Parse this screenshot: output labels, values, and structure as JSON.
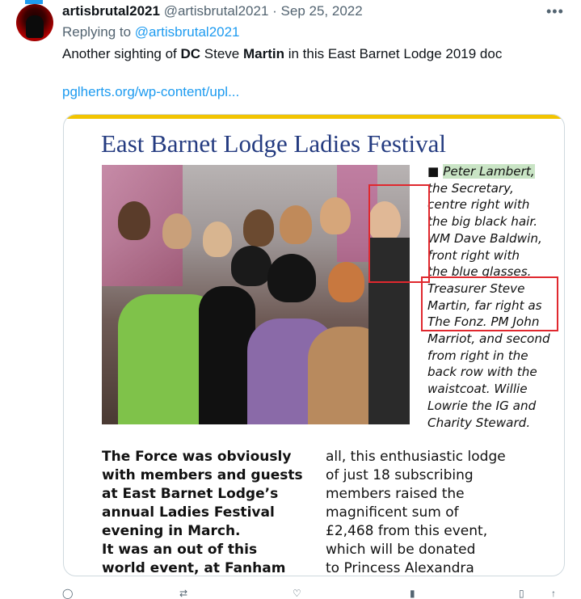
{
  "tweet": {
    "display_name": "artisbrutal2021",
    "handle": "@artisbrutal2021",
    "separator": "·",
    "date": "Sep 25, 2022",
    "more_label": "•••",
    "reply_prefix": "Replying to",
    "reply_handle": "@artisbrutal2021",
    "text_parts": [
      "Another sighting of ",
      "DC",
      " Steve ",
      "Martin",
      " in this East Barnet Lodge 2019 doc"
    ],
    "link_text": "pglherts.org/wp-content/upl..."
  },
  "document": {
    "title": "East Barnet Lodge Ladies Festival",
    "caption_lines": [
      "Peter Lambert,",
      "the Secretary,",
      "centre right with",
      "the big black hair.",
      "WM Dave Baldwin,",
      "front right with",
      "the blue glasses.",
      "Treasurer Steve",
      "Martin, far right as",
      "The Fonz. PM John",
      "Marriot, and second",
      "from right in the",
      "back row with the",
      "waistcoat. Willie",
      "Lowrie the IG and",
      "Charity Steward."
    ],
    "bullet": "■",
    "body_left_lines": [
      "The Force was obviously",
      "with members and guests",
      "at East Barnet Lodge’s",
      "annual Ladies Festival",
      "evening in March.",
      "It was an out of this",
      "world event, at Fanham"
    ],
    "body_right_lines": [
      "all, this enthusiastic lodge",
      "of just 18 subscribing",
      "members raised the",
      "magnificent sum of",
      "£2,468 from this event,",
      "which will be donated",
      "to Princess Alexandra"
    ]
  },
  "colors": {
    "link": "#1d9bf0",
    "title": "#243b80",
    "highlight_box": "#e0282e",
    "accent_bar": "#f2c400"
  }
}
